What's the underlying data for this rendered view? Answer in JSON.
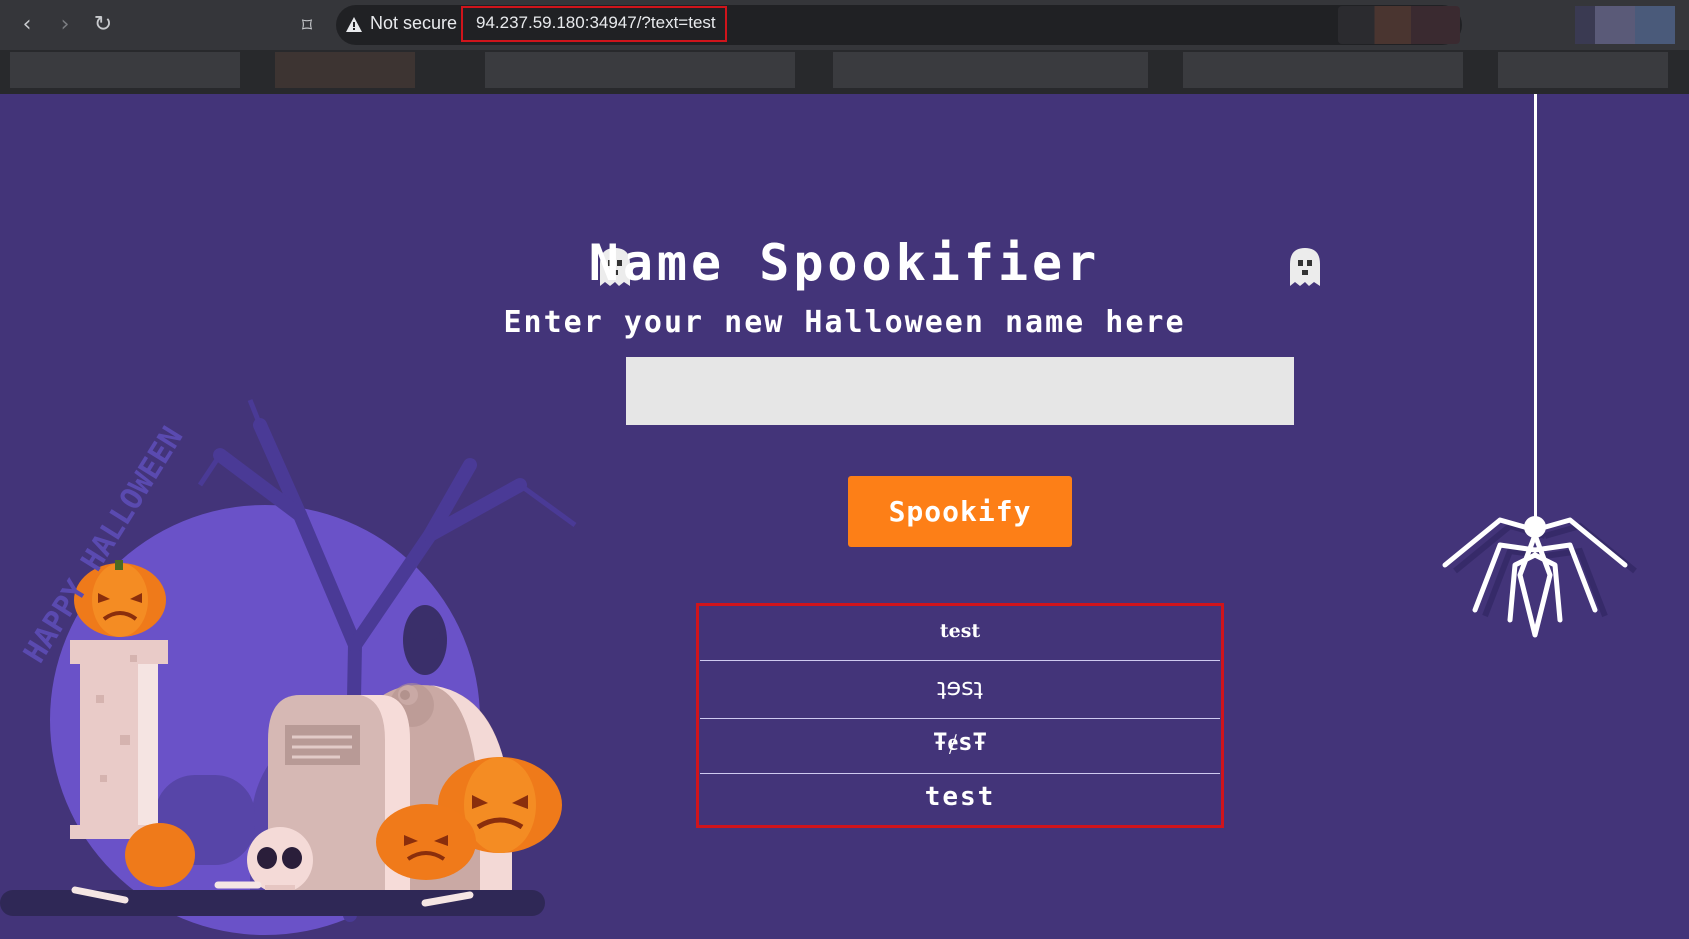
{
  "browser": {
    "security_label": "Not secure",
    "url": "94.237.59.180:34947/?text=test"
  },
  "page": {
    "title": "Name Spookifier",
    "subtitle": "Enter your new Halloween name here",
    "input_value": "",
    "button_label": "Spookify",
    "results": [
      "test",
      "ʇɘsʇ",
      "ŦɇsŦ",
      "test"
    ]
  },
  "decor": {
    "banner_text": "HAPPY HALLOWEEN"
  }
}
